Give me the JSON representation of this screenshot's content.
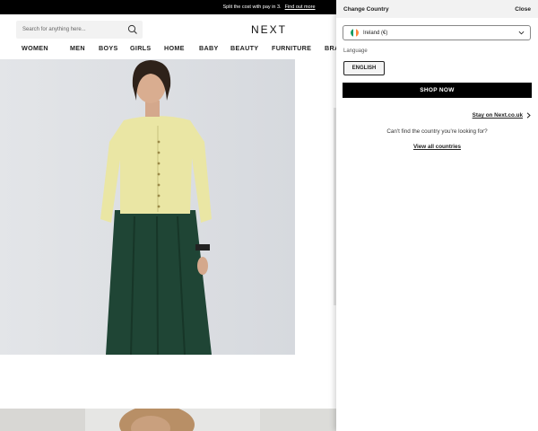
{
  "promo": {
    "text": "Split the cost with pay in 3.",
    "link": "Find out more"
  },
  "header": {
    "search_placeholder": "Search for anything here...",
    "logo": "NEXT",
    "nav": [
      "WOMEN",
      "MEN",
      "BOYS",
      "GIRLS",
      "HOME",
      "BABY",
      "BEAUTY",
      "FURNITURE",
      "BRANDS"
    ]
  },
  "country_panel": {
    "title": "Change Country",
    "close_label": "Close",
    "selected_country": "Ireland (€)",
    "language_label": "Language",
    "language_option": "ENGLISH",
    "shop_now_label": "SHOP NOW",
    "stay_link": "Stay on Next.co.uk",
    "cant_find_text": "Can't find the country you're looking for?",
    "view_all_link": "View all countries"
  },
  "colors": {
    "primary": "#000000",
    "flag_green": "#169b62",
    "flag_white": "#ffffff",
    "flag_orange": "#ff883e"
  }
}
